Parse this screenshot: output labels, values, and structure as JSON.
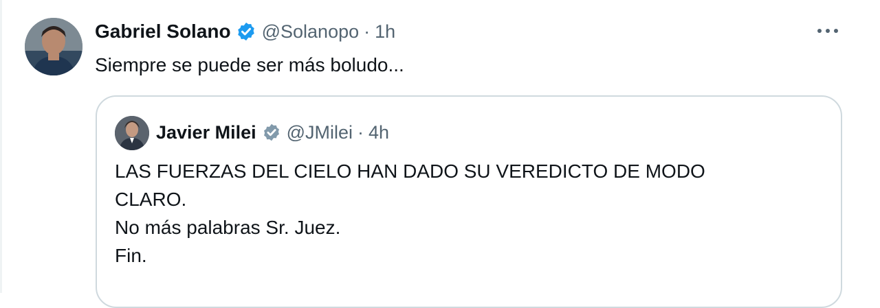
{
  "tweet": {
    "author_name": "Gabriel Solano",
    "author_handle": "@Solanopo",
    "separator": "·",
    "time": "1h",
    "text": "Siempre se puede ser más boludo...",
    "verified_icon": "verified-badge-icon",
    "more_icon": "more-options-icon"
  },
  "quote": {
    "author_name": "Javier Milei",
    "author_handle": "@JMilei",
    "separator": "·",
    "time": "4h",
    "lines": [
      "LAS FUERZAS DEL CIELO HAN DADO SU VEREDICTO DE MODO",
      "CLARO.",
      "No más palabras Sr. Juez.",
      "Fin."
    ],
    "verified_icon": "verified-badge-icon"
  },
  "colors": {
    "text_primary": "#0f1419",
    "text_secondary": "#536471",
    "verified_blue": "#1d9bf0",
    "verified_gray": "#829aab",
    "border": "#cfd9de"
  }
}
